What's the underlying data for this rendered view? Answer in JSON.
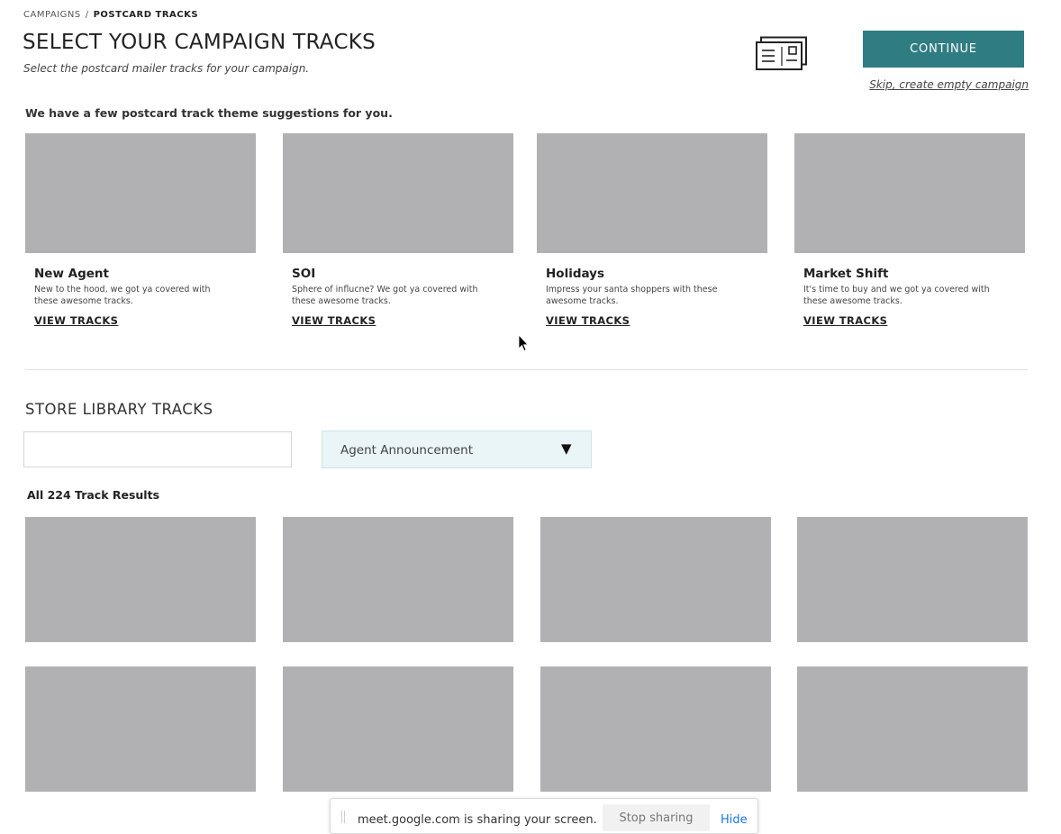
{
  "breadcrumb": {
    "parent": "CAMPAIGNS",
    "separator": "/",
    "current": "POSTCARD TRACKS"
  },
  "header": {
    "title": "SELECT YOUR CAMPAIGN TRACKS",
    "subtitle": "Select the postcard mailer tracks for your campaign.",
    "icon": "postcard-icon",
    "continue_label": "CONTINUE",
    "skip_label": "Skip, create empty campaign"
  },
  "suggestions": {
    "intro": "We have a few postcard track theme suggestions for you.",
    "cards": [
      {
        "name": "New Agent",
        "desc": "New to the hood, we got ya covered with these awesome tracks.",
        "link": "VIEW TRACKS"
      },
      {
        "name": "SOI",
        "desc": "Sphere of influcne? We got ya covered with these awesome tracks.",
        "link": "VIEW TRACKS"
      },
      {
        "name": "Holidays",
        "desc": "Impress your santa shoppers  with these awesome tracks.",
        "link": "VIEW TRACKS"
      },
      {
        "name": "Market Shift",
        "desc": "It's time to buy and we got ya covered with these awesome tracks.",
        "link": "VIEW TRACKS"
      }
    ]
  },
  "library": {
    "title": "STORE LIBRARY TRACKS",
    "search_value": "",
    "filter_value": "Agent Announcement",
    "filter_caret": "▼",
    "results_label": "All 224 Track Results"
  },
  "share_bar": {
    "text": "meet.google.com is sharing your screen.",
    "stop_label": "Stop sharing",
    "hide_label": "Hide"
  },
  "colors": {
    "accent": "#2f7d82",
    "placeholder": "#b1b1b4",
    "select_bg": "#eaf5f7",
    "link_blue": "#1a73e8"
  }
}
